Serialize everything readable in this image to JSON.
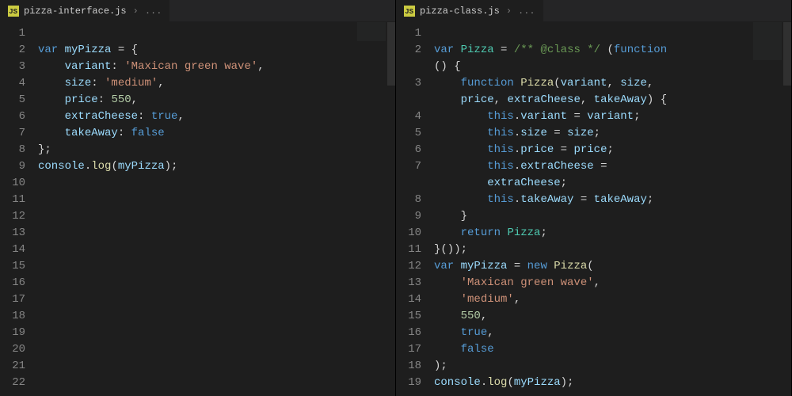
{
  "panes": [
    {
      "tab": {
        "icon": "JS",
        "filename": "pizza-interface.js",
        "breadcrumb": "..."
      },
      "lines": [
        [],
        [
          [
            "kw",
            "var"
          ],
          [
            "op",
            " "
          ],
          [
            "var",
            "myPizza"
          ],
          [
            "op",
            " "
          ],
          [
            "op",
            "="
          ],
          [
            "op",
            " "
          ],
          [
            "punc",
            "{"
          ]
        ],
        [
          [
            "op",
            "    "
          ],
          [
            "prop",
            "variant"
          ],
          [
            "punc",
            ":"
          ],
          [
            "op",
            " "
          ],
          [
            "str",
            "'Maxican green wave'"
          ],
          [
            "punc",
            ","
          ]
        ],
        [
          [
            "op",
            "    "
          ],
          [
            "prop",
            "size"
          ],
          [
            "punc",
            ":"
          ],
          [
            "op",
            " "
          ],
          [
            "str",
            "'medium'"
          ],
          [
            "punc",
            ","
          ]
        ],
        [
          [
            "op",
            "    "
          ],
          [
            "prop",
            "price"
          ],
          [
            "punc",
            ":"
          ],
          [
            "op",
            " "
          ],
          [
            "num",
            "550"
          ],
          [
            "punc",
            ","
          ]
        ],
        [
          [
            "op",
            "    "
          ],
          [
            "prop",
            "extraCheese"
          ],
          [
            "punc",
            ":"
          ],
          [
            "op",
            " "
          ],
          [
            "kw",
            "true"
          ],
          [
            "punc",
            ","
          ]
        ],
        [
          [
            "op",
            "    "
          ],
          [
            "prop",
            "takeAway"
          ],
          [
            "punc",
            ":"
          ],
          [
            "op",
            " "
          ],
          [
            "kw",
            "false"
          ]
        ],
        [
          [
            "punc",
            "};"
          ]
        ],
        [
          [
            "obj",
            "console"
          ],
          [
            "punc",
            "."
          ],
          [
            "fn",
            "log"
          ],
          [
            "punc",
            "("
          ],
          [
            "var",
            "myPizza"
          ],
          [
            "punc",
            ");"
          ]
        ],
        [],
        [],
        [],
        [],
        [],
        [],
        [],
        [],
        [],
        [],
        [],
        [],
        []
      ]
    },
    {
      "tab": {
        "icon": "JS",
        "filename": "pizza-class.js",
        "breadcrumb": "..."
      },
      "lines": [
        [],
        [
          [
            "kw",
            "var"
          ],
          [
            "op",
            " "
          ],
          [
            "class",
            "Pizza"
          ],
          [
            "op",
            " "
          ],
          [
            "op",
            "="
          ],
          [
            "op",
            " "
          ],
          [
            "comment",
            "/** @class */"
          ],
          [
            "op",
            " "
          ],
          [
            "punc",
            "("
          ],
          [
            "kw",
            "function"
          ],
          [
            "op",
            " "
          ]
        ],
        [
          [
            "punc",
            "()"
          ],
          [
            "op",
            " "
          ],
          [
            "punc",
            "{"
          ]
        ],
        [
          [
            "op",
            "    "
          ],
          [
            "kw",
            "function"
          ],
          [
            "op",
            " "
          ],
          [
            "fn",
            "Pizza"
          ],
          [
            "punc",
            "("
          ],
          [
            "var",
            "variant"
          ],
          [
            "punc",
            ","
          ],
          [
            "op",
            " "
          ],
          [
            "var",
            "size"
          ],
          [
            "punc",
            ","
          ],
          [
            "op",
            " "
          ]
        ],
        [
          [
            "op",
            "    "
          ],
          [
            "var",
            "price"
          ],
          [
            "punc",
            ","
          ],
          [
            "op",
            " "
          ],
          [
            "var",
            "extraCheese"
          ],
          [
            "punc",
            ","
          ],
          [
            "op",
            " "
          ],
          [
            "var",
            "takeAway"
          ],
          [
            "punc",
            ")"
          ],
          [
            "op",
            " "
          ],
          [
            "punc",
            "{"
          ]
        ],
        [
          [
            "op",
            "        "
          ],
          [
            "this",
            "this"
          ],
          [
            "punc",
            "."
          ],
          [
            "prop",
            "variant"
          ],
          [
            "op",
            " "
          ],
          [
            "op",
            "="
          ],
          [
            "op",
            " "
          ],
          [
            "var",
            "variant"
          ],
          [
            "punc",
            ";"
          ]
        ],
        [
          [
            "op",
            "        "
          ],
          [
            "this",
            "this"
          ],
          [
            "punc",
            "."
          ],
          [
            "prop",
            "size"
          ],
          [
            "op",
            " "
          ],
          [
            "op",
            "="
          ],
          [
            "op",
            " "
          ],
          [
            "var",
            "size"
          ],
          [
            "punc",
            ";"
          ]
        ],
        [
          [
            "op",
            "        "
          ],
          [
            "this",
            "this"
          ],
          [
            "punc",
            "."
          ],
          [
            "prop",
            "price"
          ],
          [
            "op",
            " "
          ],
          [
            "op",
            "="
          ],
          [
            "op",
            " "
          ],
          [
            "var",
            "price"
          ],
          [
            "punc",
            ";"
          ]
        ],
        [
          [
            "op",
            "        "
          ],
          [
            "this",
            "this"
          ],
          [
            "punc",
            "."
          ],
          [
            "prop",
            "extraCheese"
          ],
          [
            "op",
            " "
          ],
          [
            "op",
            "="
          ],
          [
            "op",
            " "
          ]
        ],
        [
          [
            "op",
            "        "
          ],
          [
            "var",
            "extraCheese"
          ],
          [
            "punc",
            ";"
          ]
        ],
        [
          [
            "op",
            "        "
          ],
          [
            "this",
            "this"
          ],
          [
            "punc",
            "."
          ],
          [
            "prop",
            "takeAway"
          ],
          [
            "op",
            " "
          ],
          [
            "op",
            "="
          ],
          [
            "op",
            " "
          ],
          [
            "var",
            "takeAway"
          ],
          [
            "punc",
            ";"
          ]
        ],
        [
          [
            "op",
            "    "
          ],
          [
            "punc",
            "}"
          ]
        ],
        [
          [
            "op",
            "    "
          ],
          [
            "kw",
            "return"
          ],
          [
            "op",
            " "
          ],
          [
            "class",
            "Pizza"
          ],
          [
            "punc",
            ";"
          ]
        ],
        [
          [
            "punc",
            "}());"
          ]
        ],
        [
          [
            "kw",
            "var"
          ],
          [
            "op",
            " "
          ],
          [
            "var",
            "myPizza"
          ],
          [
            "op",
            " "
          ],
          [
            "op",
            "="
          ],
          [
            "op",
            " "
          ],
          [
            "kw",
            "new"
          ],
          [
            "op",
            " "
          ],
          [
            "fn",
            "Pizza"
          ],
          [
            "punc",
            "("
          ]
        ],
        [
          [
            "op",
            "    "
          ],
          [
            "str",
            "'Maxican green wave'"
          ],
          [
            "punc",
            ","
          ]
        ],
        [
          [
            "op",
            "    "
          ],
          [
            "str",
            "'medium'"
          ],
          [
            "punc",
            ","
          ]
        ],
        [
          [
            "op",
            "    "
          ],
          [
            "num",
            "550"
          ],
          [
            "punc",
            ","
          ]
        ],
        [
          [
            "op",
            "    "
          ],
          [
            "kw",
            "true"
          ],
          [
            "punc",
            ","
          ]
        ],
        [
          [
            "op",
            "    "
          ],
          [
            "kw",
            "false"
          ]
        ],
        [
          [
            "punc",
            ");"
          ]
        ],
        [
          [
            "obj",
            "console"
          ],
          [
            "punc",
            "."
          ],
          [
            "fn",
            "log"
          ],
          [
            "punc",
            "("
          ],
          [
            "var",
            "myPizza"
          ],
          [
            "punc",
            ");"
          ]
        ]
      ],
      "lineNumbers": [
        1,
        2,
        null,
        3,
        null,
        4,
        5,
        6,
        7,
        null,
        8,
        9,
        10,
        11,
        12,
        13,
        14,
        15,
        16,
        17,
        18,
        19
      ]
    }
  ]
}
